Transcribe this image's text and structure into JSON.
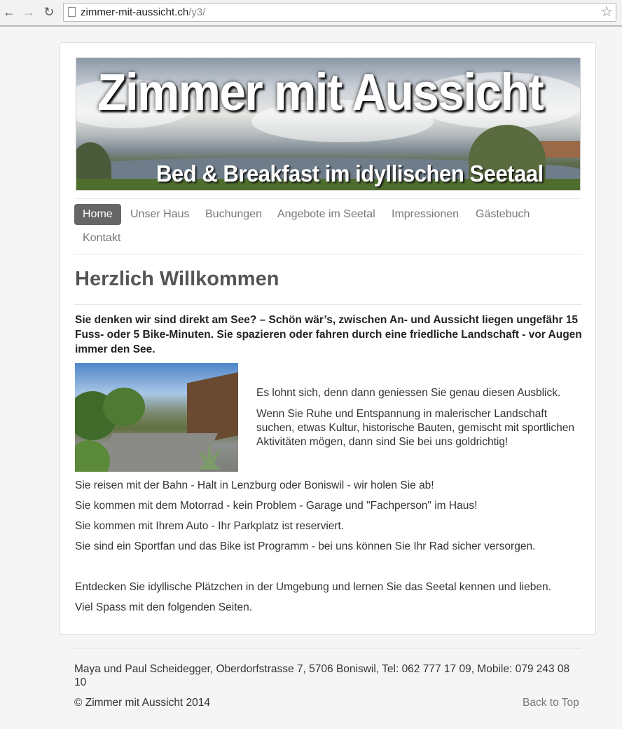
{
  "browser": {
    "url_domain": "zimmer-mit-aussicht.ch",
    "url_path": "/y3/"
  },
  "banner": {
    "title": "Zimmer mit Aussicht",
    "subtitle": "Bed & Breakfast im idyllischen Seetaal"
  },
  "nav": {
    "items": [
      {
        "label": "Home",
        "active": true
      },
      {
        "label": "Unser Haus"
      },
      {
        "label": "Buchungen"
      },
      {
        "label": "Angebote im Seetal"
      },
      {
        "label": "Impressionen"
      },
      {
        "label": "Gästebuch"
      },
      {
        "label": "Kontakt"
      }
    ]
  },
  "main": {
    "heading": "Herzlich Willkommen",
    "lead": "Sie denken wir sind direkt am See? – Schön wär’s, zwischen An- und Aussicht liegen ungefähr 15 Fuss- oder 5 Bike-Minuten. Sie spazieren oder fahren durch eine friedliche Landschaft - vor Augen immer den See.",
    "side_paragraphs": [
      "Es lohnt sich, denn dann geniessen Sie genau diesen Ausblick.",
      "Wenn Sie Ruhe und Entspannung in malerischer Landschaft suchen, etwas Kultur, historische Bauten, gemischt mit sportlichen Aktivitäten mögen, dann sind Sie bei uns goldrichtig!"
    ],
    "paragraphs": [
      "Sie reisen mit der Bahn - Halt in Lenzburg oder Boniswil - wir holen Sie ab!",
      "Sie kommen mit dem Motorrad - kein Problem - Garage und \"Fachperson\" im Haus!",
      "Sie kommen mit Ihrem Auto - Ihr Parkplatz ist reserviert.",
      "Sie sind ein Sportfan und das Bike ist Programm - bei uns können Sie Ihr Rad sicher versorgen.",
      "Entdecken Sie idyllische Plätzchen in der Umgebung und lernen Sie das Seetal kennen und lieben.",
      "Viel Spass mit den folgenden Seiten."
    ]
  },
  "footer": {
    "address": "Maya und Paul Scheidegger, Oberdorfstrasse 7, 5706 Boniswil, Tel: 062 777 17 09, Mobile: 079 243 08 10",
    "copyright": "© Zimmer mit Aussicht 2014",
    "back_to_top": "Back to Top"
  }
}
